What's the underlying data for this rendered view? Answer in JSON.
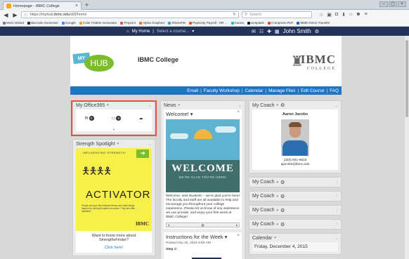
{
  "browser": {
    "tab_title": "Homepage - IBMC College",
    "tab_close": "×",
    "new_tab": "+",
    "url_prefix": "https://myhub.",
    "url_domain": "ibmc.edu",
    "url_suffix": "/d2l/home",
    "search_placeholder": "Search",
    "window_controls": [
      "–",
      "▢",
      "×"
    ],
    "bookmarks": [
      {
        "label": "Most Visited",
        "color": "#6b7c93"
      },
      {
        "label": "Barcode Generator",
        "color": "#2c2c2c"
      },
      {
        "label": "Google",
        "color": "#4285f4"
      },
      {
        "label": "Color Palette Generator",
        "color": "#e8a12f"
      },
      {
        "label": "Pinpoint",
        "color": "#d9534f"
      },
      {
        "label": "Alpha Graphics",
        "color": "#d97b2b"
      },
      {
        "label": "ShareFile",
        "color": "#3aa0d8"
      },
      {
        "label": "Paylocity Payroll - HR ...",
        "color": "#e2502f"
      },
      {
        "label": "Canva",
        "color": "#21b6c8"
      },
      {
        "label": "Unsplash",
        "color": "#222222"
      },
      {
        "label": "Compress PDF",
        "color": "#e24848"
      },
      {
        "label": "MME Direct Transfer",
        "color": "#2a62b8"
      }
    ]
  },
  "site_nav": {
    "home": "My Home",
    "course_selector": "Select a course...",
    "user": "John Smith"
  },
  "header": {
    "logo_my": "MY",
    "logo_hub": "HUB",
    "college_title": "IBMC College",
    "ibmc_big": "IBMC",
    "ibmc_small": "COLLEGE"
  },
  "top_menu": [
    "Email",
    "Faculty Workshop",
    "Calendar",
    "Manage Files",
    "Edit Course",
    "FAQ"
  ],
  "office": {
    "title": "My Office365",
    "items": [
      {
        "icon": "mail-icon",
        "count": "0"
      },
      {
        "icon": "calendar-icon",
        "count": "0"
      },
      {
        "icon": "cloud-icon",
        "count": ""
      }
    ],
    "expand": "⌄"
  },
  "strength": {
    "title": "Strength Spotlight",
    "top_text": "INFLUENCING STRENGTH",
    "headline": "ACTIVATOR",
    "desc": "People strong in the Activator theme can make things happen by turning thoughts into action. They are often impatient.",
    "brand": "IBMC",
    "question": "Want to know more about StrengthsFinder?",
    "link": "Click here!"
  },
  "news": {
    "title": "News",
    "item_title": "Welcome!",
    "banner_main": "WELCOME",
    "banner_sub": "WE'RE GLAD YOU'RE HERE!",
    "body": "Welcome, new students -- we're glad you're here! The faculty and staff are all available to help and encourage you throughout your college experience. Please let us know of any assistance we can provide, and enjoy your first week at IBMC College!",
    "instr_title": "Instructions for the Week",
    "instr_date": "Posted Nov 20, 2015 9:50 AM",
    "instr_step": "Step 1:"
  },
  "coach": {
    "title": "My Coach",
    "name": "Aaron Jacobs",
    "phone": "(303) 651-6819",
    "email": "ajacobs@ibmc.edu",
    "mini_panels": [
      "My Coach",
      "My Coach",
      "My Coach",
      "My Coach"
    ]
  },
  "calendar": {
    "title": "Calendar",
    "date": "Friday, December 4, 2015"
  },
  "colors": {
    "nav_dark": "#23325b",
    "menu_blue": "#1e74c6",
    "highlight_red": "#e4553d",
    "hub_green": "#7cbc2b"
  }
}
